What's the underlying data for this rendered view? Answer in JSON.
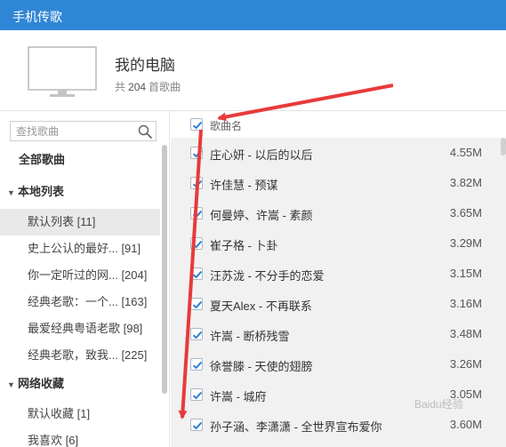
{
  "app": {
    "title": "手机传歌"
  },
  "device": {
    "name": "我的电脑",
    "count_prefix": "共",
    "count": "204",
    "count_suffix": "首歌曲",
    "icon": "monitor-icon"
  },
  "search": {
    "placeholder": "查找歌曲",
    "icon": "search-icon"
  },
  "sidebar": {
    "all_songs": "全部歌曲",
    "local_group": "本地列表",
    "local_items": [
      {
        "label": "默认列表 [11]",
        "selected": true
      },
      {
        "label": "史上公认的最好... [91]"
      },
      {
        "label": "你一定听过的网... [204]"
      },
      {
        "label": "经典老歌：一个... [163]"
      },
      {
        "label": "最爱经典粤语老歌 [98]"
      },
      {
        "label": "经典老歌，致我... [225]"
      }
    ],
    "network_group": "网络收藏",
    "network_items": [
      {
        "label": "默认收藏 [1]"
      },
      {
        "label": "我喜欢 [6]"
      }
    ]
  },
  "list": {
    "header": "歌曲名",
    "songs": [
      {
        "name": "庄心妍 - 以后的以后",
        "size": "4.55M"
      },
      {
        "name": "许佳慧 - 预谋",
        "size": "3.82M"
      },
      {
        "name": "何曼婷、许嵩 - 素颜",
        "size": "3.65M"
      },
      {
        "name": "崔子格 - 卜卦",
        "size": "3.29M"
      },
      {
        "name": "汪苏泷 - 不分手的恋爱",
        "size": "3.15M"
      },
      {
        "name": "夏天Alex - 不再联系",
        "size": "3.16M"
      },
      {
        "name": "许嵩 - 断桥残雪",
        "size": "3.48M"
      },
      {
        "name": "徐誉滕 - 天使的翅膀",
        "size": "3.26M"
      },
      {
        "name": "许嵩 - 城府",
        "size": "3.05M"
      },
      {
        "name": "孙子涵、李潇潇 - 全世界宣布爱你",
        "size": "3.60M"
      }
    ]
  },
  "watermark": "Baidu经验",
  "colors": {
    "titlebar": "#2f86d6",
    "check": "#2d7fd0",
    "arrow": "#e83a3a"
  }
}
